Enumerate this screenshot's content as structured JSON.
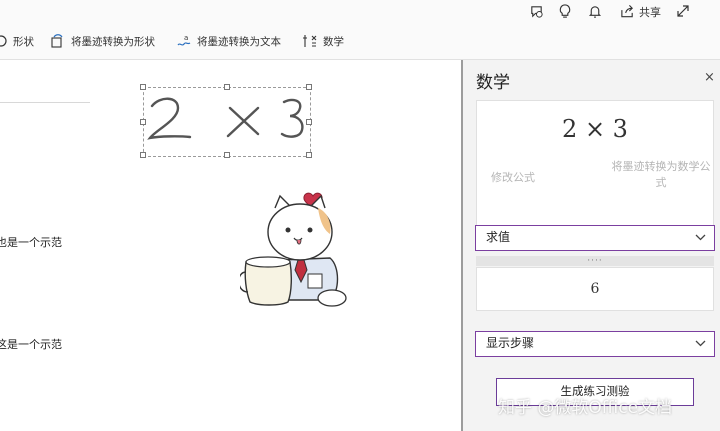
{
  "titlebar": {
    "share_label": "共享",
    "icons": [
      "comments-icon",
      "lightbulb-icon",
      "bell-icon",
      "share-icon",
      "expand-icon"
    ]
  },
  "ribbon": {
    "shapes_label": "形状",
    "ink_to_shape_label": "将墨迹转换为形状",
    "ink_to_text_label": "将墨迹转换为文本",
    "math_label": "数学"
  },
  "document": {
    "line1": "也是一个示范",
    "line2": "这是一个示范",
    "ink_expression": "2 × 3"
  },
  "math_pane": {
    "title": "数学",
    "close": "×",
    "equation": "2 × 3",
    "edit_formula": "修改公式",
    "ink_to_math": "将墨迹转换为数学公式",
    "action_select": "求值",
    "grip": "····",
    "result": "6",
    "steps_select": "显示步骤",
    "quiz_button": "生成练习测验"
  },
  "watermark": "知乎 @微软Office文档",
  "colors": {
    "accent": "#7b3fa0",
    "heart": "#c8334a"
  }
}
